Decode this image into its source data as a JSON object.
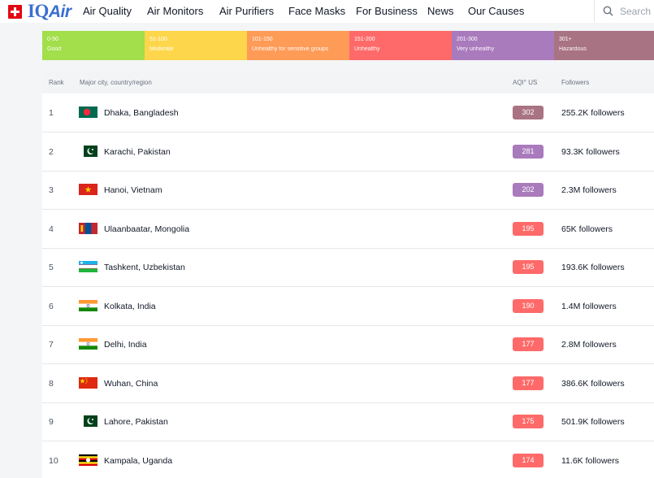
{
  "header": {
    "brand_prefix": "IQ",
    "brand_suffix": "Air",
    "nav": [
      "Air Quality",
      "Air Monitors",
      "Air Purifiers",
      "Face Masks",
      "For Business",
      "News",
      "Our Causes"
    ],
    "search_placeholder": "Search"
  },
  "aqi_scale": [
    {
      "range": "0-50",
      "label": "Good",
      "color": "#a3de4b"
    },
    {
      "range": "51-100",
      "label": "Moderate",
      "color": "#fdd64b"
    },
    {
      "range": "101-150",
      "label": "Unhealthy for sensitive groups",
      "color": "#fe9b57"
    },
    {
      "range": "151-200",
      "label": "Unhealthy",
      "color": "#fe6a69"
    },
    {
      "range": "201-300",
      "label": "Very unhealthy",
      "color": "#a97abc"
    },
    {
      "range": "301+",
      "label": "Hazardous",
      "color": "#a87383"
    }
  ],
  "table": {
    "columns": {
      "rank": "Rank",
      "city": "Major city, country/region",
      "aqi": "AQI° US",
      "followers": "Followers"
    },
    "rows": [
      {
        "rank": "1",
        "flag": "bangladesh-flag",
        "city": "Dhaka, Bangladesh",
        "aqi": "302",
        "aqi_color": "#a87383",
        "followers": "255.2K followers"
      },
      {
        "rank": "2",
        "flag": "pakistan-flag",
        "city": "Karachi, Pakistan",
        "aqi": "281",
        "aqi_color": "#a97abc",
        "followers": "93.3K followers"
      },
      {
        "rank": "3",
        "flag": "vietnam-flag",
        "city": "Hanoi, Vietnam",
        "aqi": "202",
        "aqi_color": "#a97abc",
        "followers": "2.3M followers"
      },
      {
        "rank": "4",
        "flag": "mongolia-flag",
        "city": "Ulaanbaatar, Mongolia",
        "aqi": "195",
        "aqi_color": "#fe6a69",
        "followers": "65K followers"
      },
      {
        "rank": "5",
        "flag": "uzbekistan-flag",
        "city": "Tashkent, Uzbekistan",
        "aqi": "195",
        "aqi_color": "#fe6a69",
        "followers": "193.6K followers"
      },
      {
        "rank": "6",
        "flag": "india-flag",
        "city": "Kolkata, India",
        "aqi": "190",
        "aqi_color": "#fe6a69",
        "followers": "1.4M followers"
      },
      {
        "rank": "7",
        "flag": "india-flag",
        "city": "Delhi, India",
        "aqi": "177",
        "aqi_color": "#fe6a69",
        "followers": "2.8M followers"
      },
      {
        "rank": "8",
        "flag": "china-flag",
        "city": "Wuhan, China",
        "aqi": "177",
        "aqi_color": "#fe6a69",
        "followers": "386.6K followers"
      },
      {
        "rank": "9",
        "flag": "pakistan-flag",
        "city": "Lahore, Pakistan",
        "aqi": "175",
        "aqi_color": "#fe6a69",
        "followers": "501.9K followers"
      },
      {
        "rank": "10",
        "flag": "uganda-flag",
        "city": "Kampala, Uganda",
        "aqi": "174",
        "aqi_color": "#fe6a69",
        "followers": "11.6K followers"
      }
    ]
  }
}
